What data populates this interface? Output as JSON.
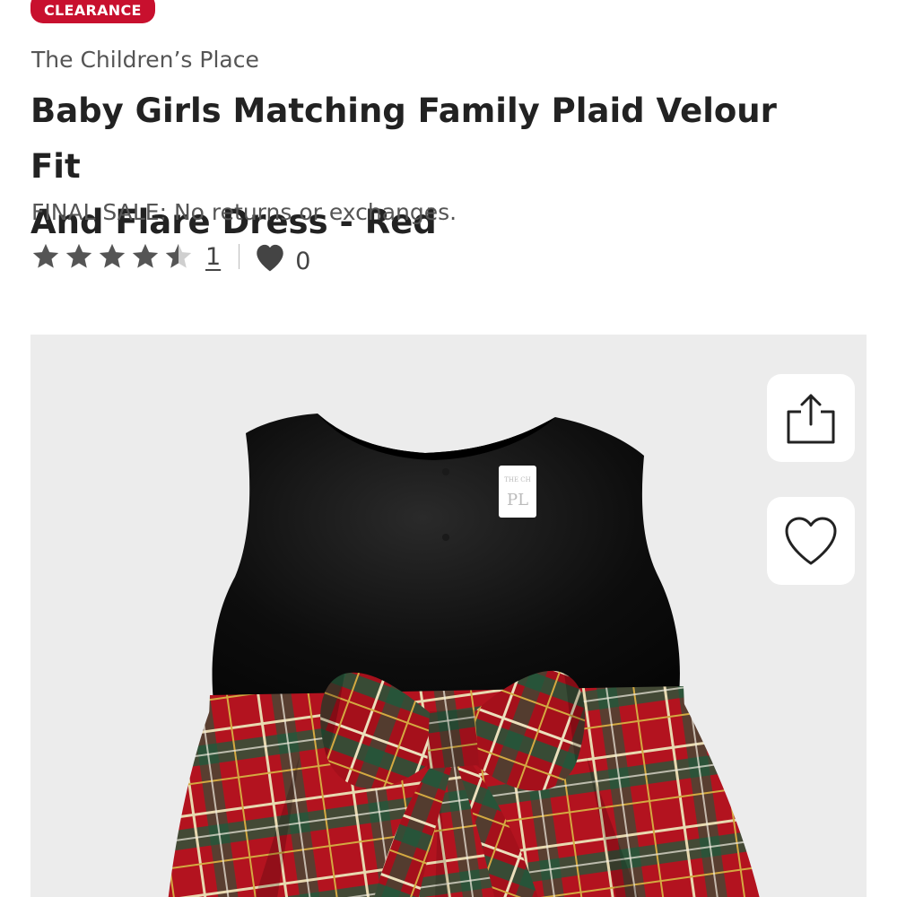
{
  "badge": {
    "label": "CLEARANCE",
    "color": "#c8102e"
  },
  "product": {
    "brand": "The Children’s Place",
    "title_line1": "Baby Girls Matching Family Plaid Velour Fit",
    "title_line2": "And Flare Dress - Red",
    "final_sale": "FINAL SALE: No returns or exchanges.",
    "rating": 4.5,
    "rating_max": 5,
    "review_count": "1",
    "favorites_count": "0"
  },
  "image": {
    "label_text_top": "THE CH",
    "label_text_main": "PL",
    "share_icon": "share-icon",
    "wishlist_icon": "heart-outline-icon"
  },
  "colors": {
    "star": "#555555",
    "velvet": "#0b0b0b",
    "plaid_red": "#b3131f",
    "plaid_green": "#1d5a3c",
    "panel_bg": "#ececec"
  }
}
